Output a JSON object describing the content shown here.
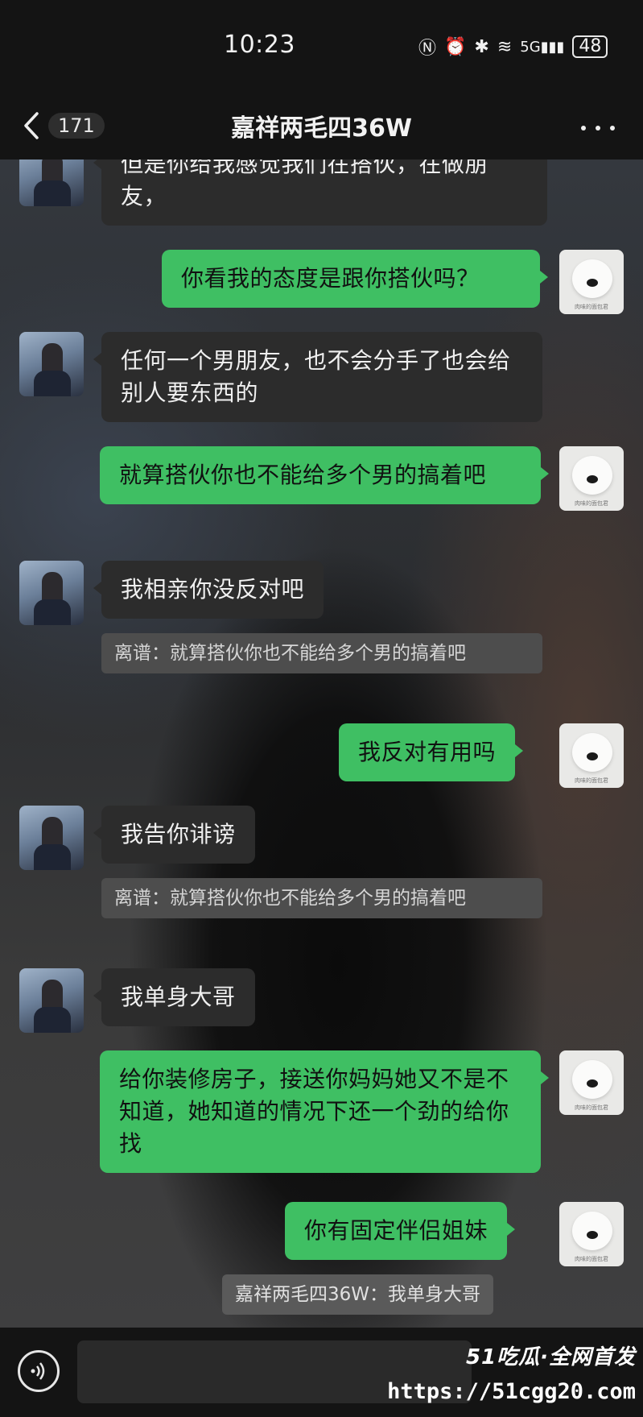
{
  "status": {
    "time": "10:23",
    "icons": [
      "nfc-icon",
      "alarm-icon",
      "bluetooth-icon",
      "wifi-icon",
      "signal-5g-icon"
    ],
    "battery": "48"
  },
  "header": {
    "unread_count": "171",
    "title": "嘉祥两毛四36W"
  },
  "messages": [
    {
      "from": "her",
      "text": "但是你给我感觉我们在搭伙，在做朋友，"
    },
    {
      "from": "me",
      "text": "你看我的态度是跟你搭伙吗？"
    },
    {
      "from": "her",
      "text": "任何一个男朋友，也不会分手了也会给别人要东西的"
    },
    {
      "from": "me",
      "text": "就算搭伙你也不能给多个男的搞着吧"
    },
    {
      "from": "her",
      "text": "我相亲你没反对吧"
    },
    {
      "quote": "离谱：就算搭伙你也不能给多个男的搞着吧"
    },
    {
      "from": "me",
      "text": "我反对有用吗"
    },
    {
      "from": "her",
      "text": "我告你诽谤"
    },
    {
      "quote": "离谱：就算搭伙你也不能给多个男的搞着吧"
    },
    {
      "from": "her",
      "text": "我单身大哥"
    },
    {
      "from": "me",
      "text": "给你装修房子，接送你妈妈她又不是不知道，她知道的情况下还一个劲的给你找"
    },
    {
      "from": "me",
      "text": "你有固定伴侣姐妹"
    },
    {
      "quote": "嘉祥两毛四36W：我单身大哥"
    }
  ],
  "avatar_caption": "肉味的面包君",
  "watermark": {
    "brand": "51吃瓜·全网首发",
    "url": "https://51cgg20.com"
  }
}
